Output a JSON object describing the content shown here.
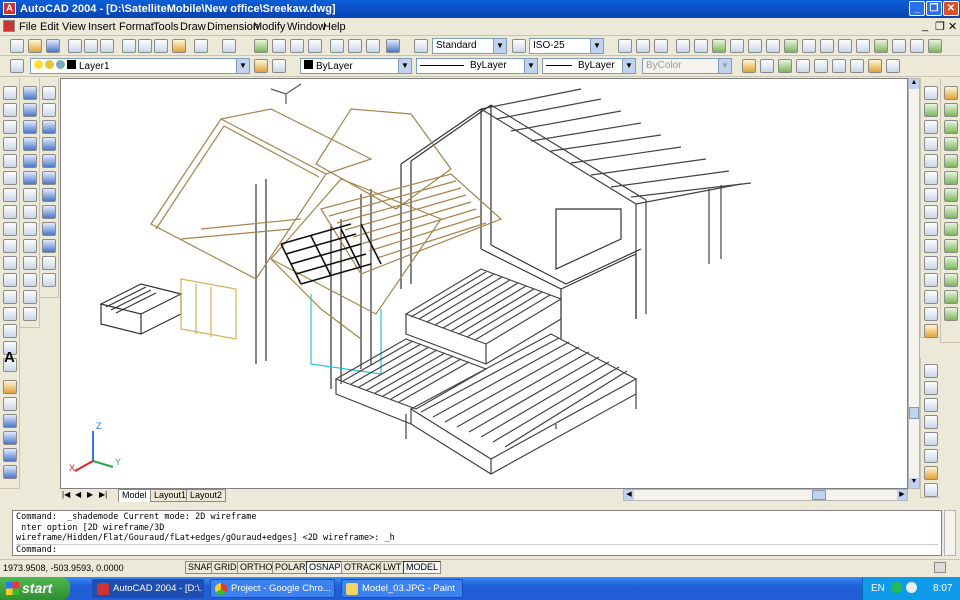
{
  "window": {
    "title": "AutoCAD 2004 - [D:\\SatelliteMobile\\New office\\Sreekaw.dwg]",
    "app_icon": "autocad-icon"
  },
  "menu": [
    "File",
    "Edit",
    "View",
    "Insert",
    "Format",
    "Tools",
    "Draw",
    "Dimension",
    "Modify",
    "Window",
    "Help"
  ],
  "toolbar": {
    "text_style": "Standard",
    "dim_style": "ISO-25"
  },
  "layers": {
    "current_layer": "Layer1",
    "color": "ByLayer",
    "linetype": "ByLayer",
    "lineweight": "ByLayer",
    "plot_style": "ByColor"
  },
  "ucs": {
    "x": "X",
    "y": "Y",
    "z": "Z"
  },
  "tabs": [
    "Model",
    "Layout1",
    "Layout2"
  ],
  "command_history": [
    "Command:  _shademode Current mode: 2D wireframe",
    " nter option [2D wireframe/3D",
    "wireframe/Hidden/Flat/Gouraud/fLat+edges/gOuraud+edges] <2D wireframe>: _h",
    "Command:"
  ],
  "status": {
    "coordinates": "1973.9508, -503.9593, 0.0000",
    "buttons": [
      "SNAP",
      "GRID",
      "ORTHO",
      "POLAR",
      "OSNAP",
      "OTRACK",
      "LWT",
      "MODEL"
    ],
    "active_buttons": [
      "OSNAP",
      "MODEL"
    ]
  },
  "taskbar": {
    "start": "start",
    "tasks": [
      {
        "label": "AutoCAD 2004 - [D:\\...",
        "icon": "autocad-icon",
        "active": true
      },
      {
        "label": "Project - Google Chro...",
        "icon": "chrome-icon",
        "active": false
      },
      {
        "label": "Model_03.JPG - Paint",
        "icon": "paint-icon",
        "active": false
      }
    ],
    "language": "EN",
    "clock": "8:07"
  }
}
